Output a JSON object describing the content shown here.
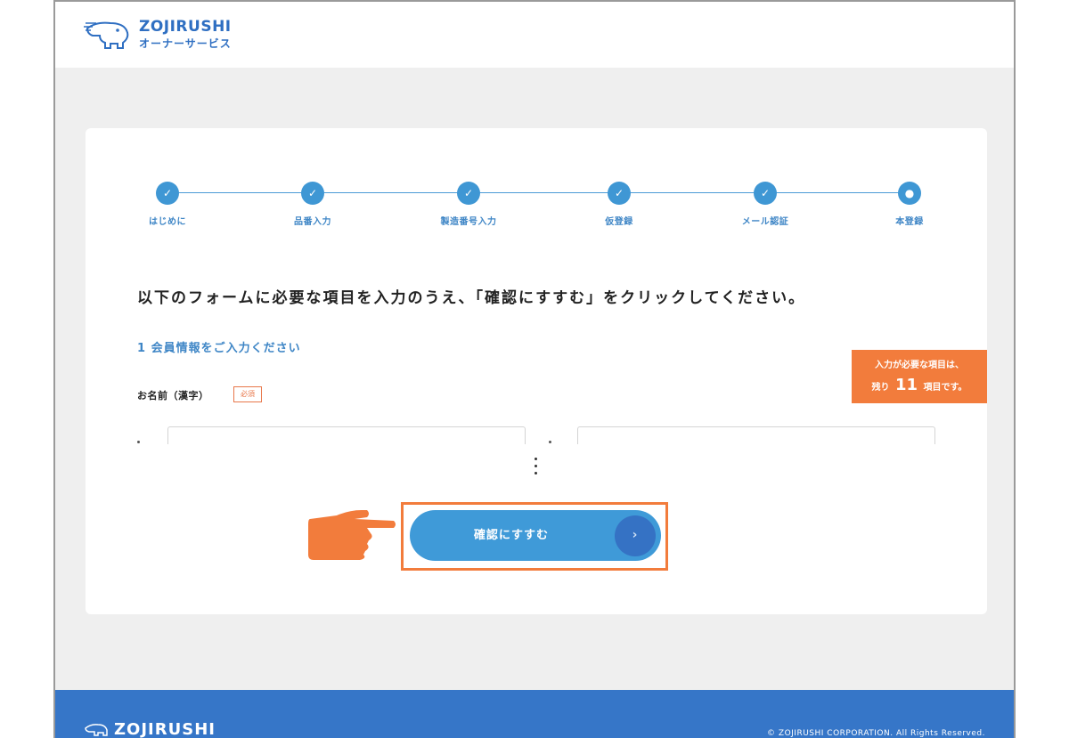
{
  "header": {
    "brand": "ZOJIRUSHI",
    "subtitle": "オーナーサービス",
    "logo_icon": "elephant-logo-icon"
  },
  "steps": [
    {
      "label": "はじめに",
      "state": "done"
    },
    {
      "label": "品番入力",
      "state": "done"
    },
    {
      "label": "製造番号入力",
      "state": "done"
    },
    {
      "label": "仮登録",
      "state": "done"
    },
    {
      "label": "メール認証",
      "state": "done"
    },
    {
      "label": "本登録",
      "state": "current"
    }
  ],
  "form": {
    "instruction": "以下のフォームに必要な項目を入力のうえ、「確認にすすむ」をクリックしてください。",
    "section_title": "1  会員情報をご入力ください",
    "name_label": "お名前（漢字）",
    "required_badge": "必須",
    "last_name_value": "",
    "first_name_value": ""
  },
  "remaining_notice": {
    "line1": "入力が必要な項目は、",
    "prefix": "残り",
    "count": "11",
    "suffix": "項目です。"
  },
  "confirm_button": {
    "label": "確認にすすむ",
    "arrow": "›"
  },
  "footer": {
    "brand": "ZOJIRUSHI",
    "copyright": "© ZOJIRUSHI CORPORATION. All Rights Reserved."
  },
  "colors": {
    "brand_blue": "#3676c8",
    "step_blue": "#3f97d4",
    "accent_orange": "#f27c3c",
    "background_gray": "#efefef"
  }
}
